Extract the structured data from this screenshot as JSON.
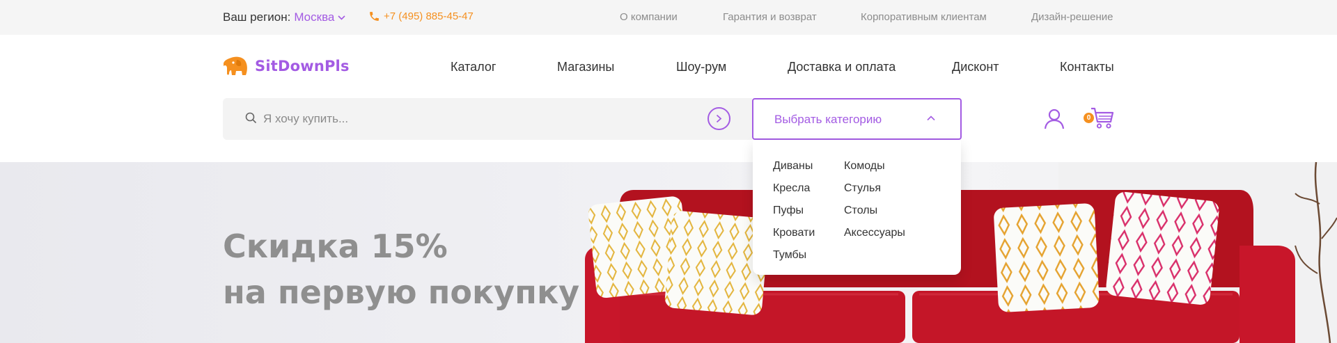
{
  "topbar": {
    "region_label": "Ваш регион:",
    "region_city": "Москва",
    "phone": "+7 (495) 885-45-47",
    "links": [
      "О компании",
      "Гарантия и возврат",
      "Корпоративным клиентам",
      "Дизайн-решение"
    ]
  },
  "header": {
    "logo_text": "SitDownPls",
    "nav": [
      "Каталог",
      "Магазины",
      "Шоу-рум",
      "Доставка и оплата",
      "Дисконт",
      "Контакты"
    ]
  },
  "search": {
    "placeholder": "Я хочу купить...",
    "value": ""
  },
  "category_select": {
    "label": "Выбрать категорию",
    "options_col1": [
      "Диваны",
      "Кресла",
      "Пуфы",
      "Кровати",
      "Тумбы"
    ],
    "options_col2": [
      "Комоды",
      "Стулья",
      "Столы",
      "Аксессуары"
    ]
  },
  "cart": {
    "count": "0"
  },
  "hero": {
    "line1": "Скидка 15%",
    "line2": "на первую покупку"
  },
  "colors": {
    "accent": "#a35be3",
    "orange": "#f5901f",
    "sofa": "#c8162a"
  },
  "icons": {
    "city_dropdown": "chevron-down-icon",
    "phone": "phone-icon",
    "logo": "elephant-icon",
    "search": "search-icon",
    "submit": "arrow-right-circle-icon",
    "select": "chevron-up-icon",
    "user": "user-icon",
    "cart": "cart-icon"
  }
}
